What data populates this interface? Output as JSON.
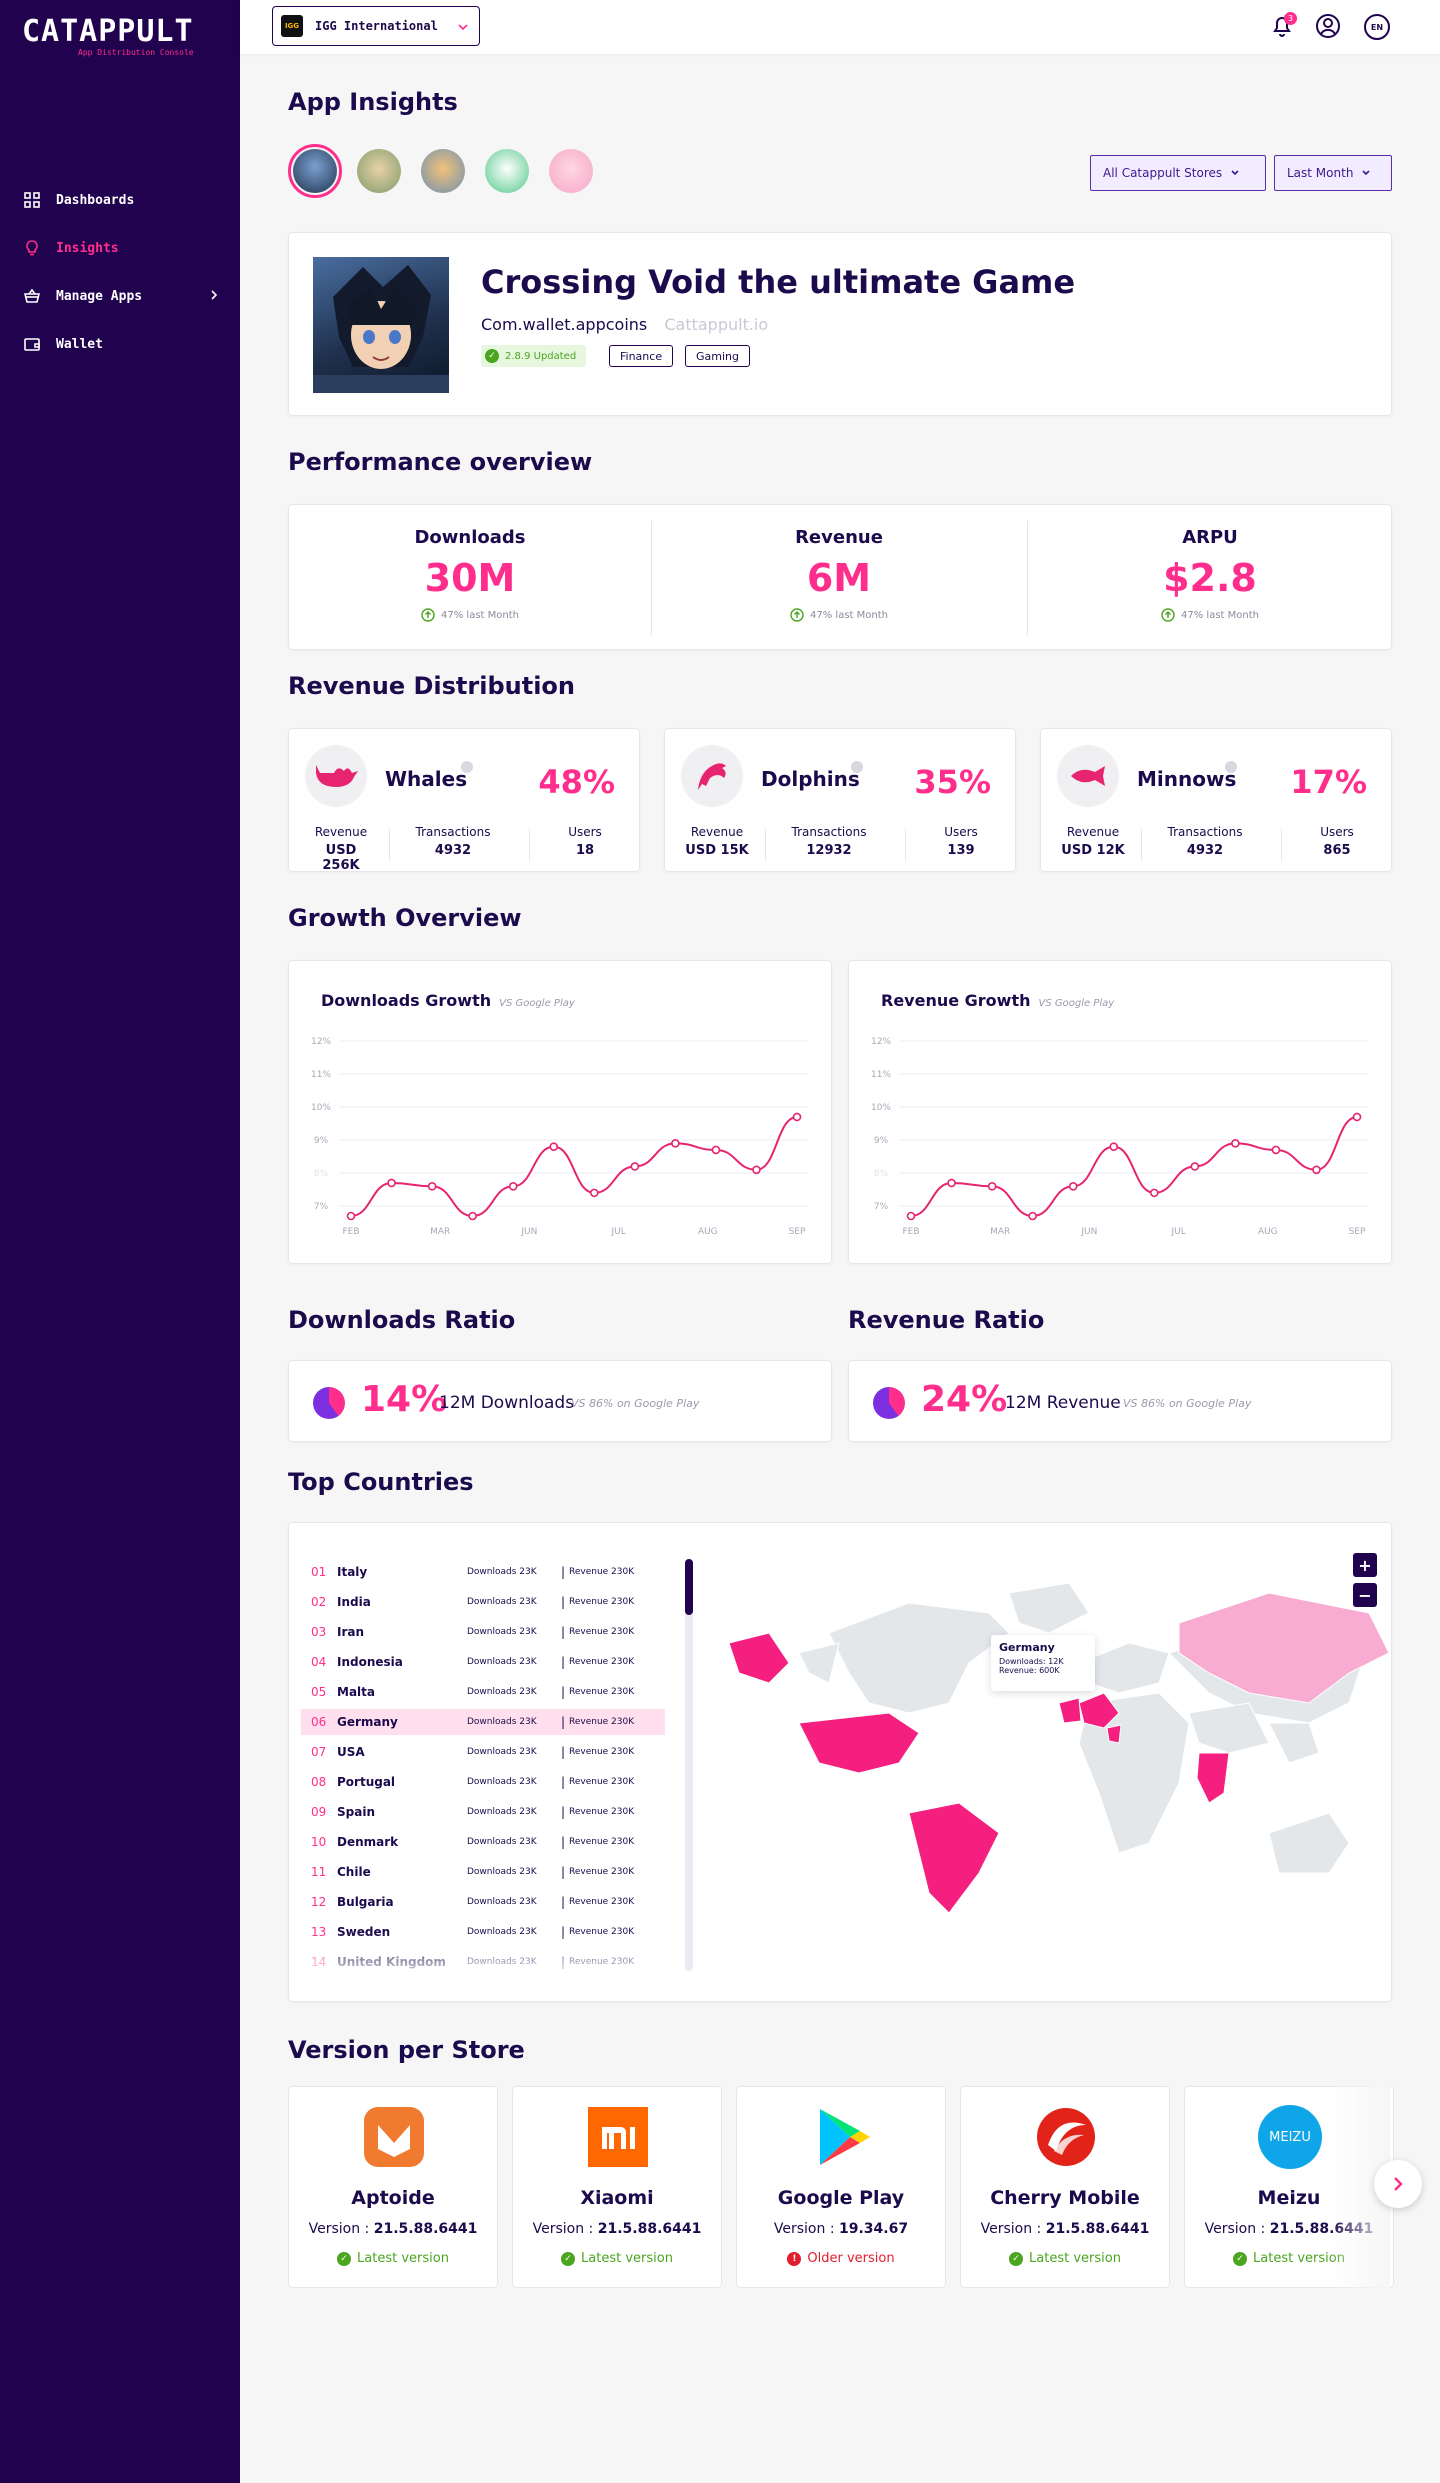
{
  "sidebar": {
    "logo": "CATAPPULT",
    "logo_sub": "App Distribution Console",
    "items": [
      {
        "label": "Dashboards",
        "icon": "grid-icon"
      },
      {
        "label": "Insights",
        "icon": "lightbulb-icon"
      },
      {
        "label": "Manage Apps",
        "icon": "basket-icon"
      },
      {
        "label": "Wallet",
        "icon": "wallet-icon"
      }
    ]
  },
  "topbar": {
    "org_logo": "IGG",
    "org_name": "IGG International",
    "notification_count": "3",
    "lang": "EN"
  },
  "app_insights": {
    "title": "App Insights",
    "filters": {
      "store": "All Catappult Stores",
      "period": "Last Month"
    }
  },
  "app": {
    "name": "Crossing Void the ultimate Game",
    "package": "Com.wallet.appcoins",
    "source": "Cattappult.io",
    "version_badge": "2.8.9 Updated",
    "tags": [
      "Finance",
      "Gaming"
    ]
  },
  "performance": {
    "title": "Performance overview",
    "items": [
      {
        "label": "Downloads",
        "value": "30M",
        "delta": "47% last Month"
      },
      {
        "label": "Revenue",
        "value": "6M",
        "delta": "47% last Month"
      },
      {
        "label": "ARPU",
        "value": "$2.8",
        "delta": "47% last Month"
      }
    ]
  },
  "revenue_distribution": {
    "title": "Revenue Distribution",
    "stat_labels": {
      "revenue": "Revenue",
      "transactions": "Transactions",
      "users": "Users"
    },
    "segments": [
      {
        "name": "Whales",
        "pct": "48%",
        "revenue": "USD 256K",
        "transactions": "4932",
        "users": "18"
      },
      {
        "name": "Dolphins",
        "pct": "35%",
        "revenue": "USD 15K",
        "transactions": "12932",
        "users": "139"
      },
      {
        "name": "Minnows",
        "pct": "17%",
        "revenue": "USD 12K",
        "transactions": "4932",
        "users": "865"
      }
    ]
  },
  "growth": {
    "title": "Growth Overview",
    "downloads_title": "Downloads Growth",
    "revenue_title": "Revenue Growth",
    "vs": "VS Google Play"
  },
  "chart_data": [
    {
      "type": "line",
      "title": "Downloads Growth",
      "y_ticks": [
        "12%",
        "11%",
        "10%",
        "9%",
        "8%",
        "7%"
      ],
      "x_ticks": [
        "FEB",
        "MAR",
        "JUN",
        "JUL",
        "AUG",
        "SEP"
      ],
      "ylim": [
        6.7,
        12
      ],
      "x": [
        0,
        0.5,
        1,
        1.5,
        2,
        2.5,
        3,
        3.5,
        4,
        4.5,
        5,
        5.5,
        6
      ],
      "values": [
        6.7,
        7.7,
        7.6,
        6.7,
        7.6,
        8.8,
        7.4,
        8.2,
        8.9,
        8.7,
        8.1,
        9.7
      ],
      "color": "#e6246f"
    },
    {
      "type": "line",
      "title": "Revenue Growth",
      "y_ticks": [
        "12%",
        "11%",
        "10%",
        "9%",
        "8%",
        "7%"
      ],
      "x_ticks": [
        "FEB",
        "MAR",
        "JUN",
        "JUL",
        "AUG",
        "SEP"
      ],
      "ylim": [
        6.7,
        12
      ],
      "values": [
        6.7,
        7.7,
        7.6,
        6.7,
        7.6,
        8.8,
        7.4,
        8.2,
        8.9,
        8.7,
        8.1,
        9.7
      ],
      "color": "#e6246f"
    }
  ],
  "ratios": {
    "downloads_title": "Downloads Ratio",
    "revenue_title": "Revenue Ratio",
    "downloads": {
      "pct": "14%",
      "text": "12M Downloads",
      "vs": "VS 86% on Google Play"
    },
    "revenue": {
      "pct": "24%",
      "text": "12M Revenue",
      "vs": "VS 86% on Google Play"
    }
  },
  "countries": {
    "title": "Top Countries",
    "rows": [
      {
        "num": "01",
        "name": "Italy",
        "downloads": "Downloads 23K",
        "revenue": "Revenue 230K"
      },
      {
        "num": "02",
        "name": "India",
        "downloads": "Downloads 23K",
        "revenue": "Revenue 230K"
      },
      {
        "num": "03",
        "name": "Iran",
        "downloads": "Downloads 23K",
        "revenue": "Revenue 230K"
      },
      {
        "num": "04",
        "name": "Indonesia",
        "downloads": "Downloads 23K",
        "revenue": "Revenue 230K"
      },
      {
        "num": "05",
        "name": "Malta",
        "downloads": "Downloads 23K",
        "revenue": "Revenue 230K"
      },
      {
        "num": "06",
        "name": "Germany",
        "downloads": "Downloads 23K",
        "revenue": "Revenue 230K"
      },
      {
        "num": "07",
        "name": "USA",
        "downloads": "Downloads 23K",
        "revenue": "Revenue 230K"
      },
      {
        "num": "08",
        "name": "Portugal",
        "downloads": "Downloads 23K",
        "revenue": "Revenue 230K"
      },
      {
        "num": "09",
        "name": "Spain",
        "downloads": "Downloads 23K",
        "revenue": "Revenue 230K"
      },
      {
        "num": "10",
        "name": "Denmark",
        "downloads": "Downloads 23K",
        "revenue": "Revenue 230K"
      },
      {
        "num": "11",
        "name": "Chile",
        "downloads": "Downloads 23K",
        "revenue": "Revenue 230K"
      },
      {
        "num": "12",
        "name": "Bulgaria",
        "downloads": "Downloads 23K",
        "revenue": "Revenue 230K"
      },
      {
        "num": "13",
        "name": "Sweden",
        "downloads": "Downloads 23K",
        "revenue": "Revenue 230K"
      },
      {
        "num": "14",
        "name": "United Kingdom",
        "downloads": "Downloads 23K",
        "revenue": "Revenue 230K"
      }
    ],
    "tooltip": {
      "country": "Germany",
      "downloads": "Downloads: 12K",
      "revenue": "Revenue: 600K"
    },
    "zoom_in": "+",
    "zoom_out": "−"
  },
  "stores": {
    "title": "Version per Store",
    "items": [
      {
        "name": "Aptoide",
        "version_label": "Version :",
        "version": "21.5.88.6441",
        "status": "Latest version"
      },
      {
        "name": "Xiaomi",
        "version_label": "Version :",
        "version": "21.5.88.6441",
        "status": "Latest version"
      },
      {
        "name": "Google Play",
        "version_label": "Version :",
        "version": "19.34.67",
        "status": "Older  version"
      },
      {
        "name": "Cherry Mobile",
        "version_label": "Version :",
        "version": "21.5.88.6441",
        "status": "Latest version"
      },
      {
        "name": "Meizu",
        "version_label": "Version :",
        "version": "21.5.88.6441",
        "status": "Latest version"
      }
    ],
    "meizu_logo_text": "MEIZU"
  }
}
